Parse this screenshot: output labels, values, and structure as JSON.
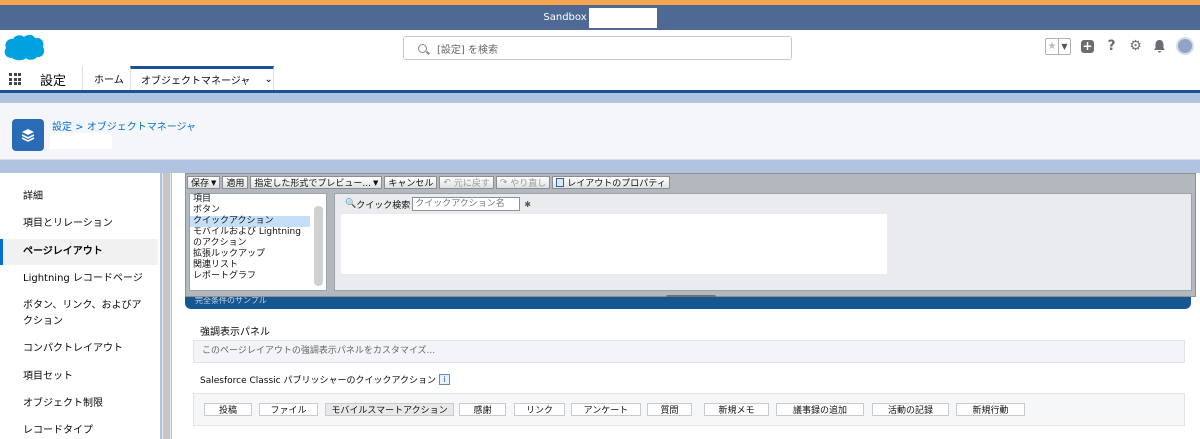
{
  "sandbox_bar": {
    "label": "Sandbox"
  },
  "global_header": {
    "search_placeholder": "[設定] を検索"
  },
  "nav": {
    "app_name": "設定",
    "home_tab": "ホーム",
    "active_tab": "オブジェクトマネージャ"
  },
  "page_header": {
    "breadcrumb": "設定 > オブジェクトマネージャ"
  },
  "sidebar": {
    "items": [
      {
        "label": "詳細"
      },
      {
        "label": "項目とリレーション"
      },
      {
        "label": "ページレイアウト"
      },
      {
        "label": "Lightning レコードページ"
      },
      {
        "label": "ボタン、リンク、およびアクション"
      },
      {
        "label": "コンパクトレイアウト"
      },
      {
        "label": "項目セット"
      },
      {
        "label": "オブジェクト制限"
      },
      {
        "label": "レコードタイプ"
      }
    ]
  },
  "palette": {
    "toolbar": {
      "save": "保存",
      "apply": "適用",
      "preview": "指定した形式でプレビュー...",
      "cancel": "キャンセル",
      "undo": "元に戻す",
      "redo": "やり直し",
      "layout_props": "レイアウトのプロパティ"
    },
    "categories": [
      {
        "label": "項目"
      },
      {
        "label": "ボタン"
      },
      {
        "label": "クイックアクション"
      },
      {
        "label": "モバイルおよび Lightning のアクション"
      },
      {
        "label": "拡張ルックアップ"
      },
      {
        "label": "関連リスト"
      },
      {
        "label": "レポートグラフ"
      }
    ],
    "quick_search_label": "クイック検索",
    "quick_search_placeholder": "クイックアクション名"
  },
  "layout": {
    "strip_label": "完全条件のサンプル",
    "highlights_title": "強調表示パネル",
    "highlights_placeholder": "このページレイアウトの強調表示パネルをカスタマイズ...",
    "publisher_title": "Salesforce Classic パブリッシャーのクイックアクション",
    "publisher_info": "i",
    "actions": [
      {
        "label": "投稿"
      },
      {
        "label": "ファイル"
      },
      {
        "label": "モバイルスマートアクション"
      },
      {
        "label": "感謝"
      },
      {
        "label": "リンク"
      },
      {
        "label": "アンケート"
      },
      {
        "label": "質問"
      },
      {
        "label": "新規メモ"
      },
      {
        "label": "議事録の追加"
      },
      {
        "label": "活動の記録"
      },
      {
        "label": "新規行動"
      }
    ]
  },
  "colors": {
    "brand_blue": "#0070d2",
    "nav_accent": "#1b5297",
    "sandbox_bar": "#4e6a94",
    "top_accent": "#f6a652"
  }
}
